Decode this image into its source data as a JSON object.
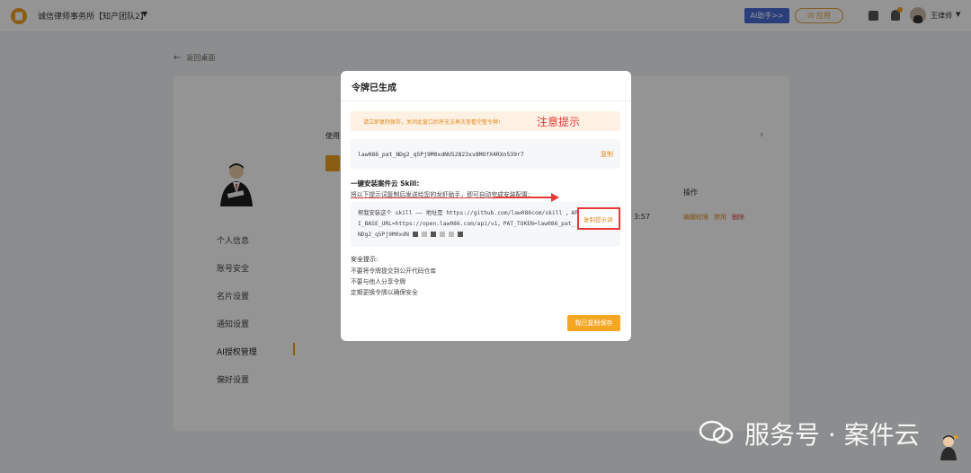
{
  "topbar": {
    "logo_glyph": "▆",
    "firm_name": "诚信律师事务所【知产团队2】",
    "ai_button": "AI助手>>",
    "use_button": "☒ 应用",
    "user_name": "王律师"
  },
  "back_link": "返回桌面",
  "background_page": {
    "usage_label": "使用",
    "ops_header": "操作",
    "time_fragment": "3:57",
    "ops": [
      "编辑权限",
      "禁用",
      "删除"
    ],
    "sidebar": [
      {
        "label": "个人信息"
      },
      {
        "label": "账号安全"
      },
      {
        "label": "名片设置"
      },
      {
        "label": "通知设置"
      },
      {
        "label": "AI授权管理",
        "active": true
      },
      {
        "label": "偏好设置"
      }
    ]
  },
  "modal": {
    "title": "令牌已生成",
    "warning": "请立即复制保存，关闭此窗口后将无法再次查看完整令牌!",
    "annotation": "注意提示",
    "token": "law086_pat_NDg2_q5Pj9M0xdNU52823xv8MOfX4RXn539r7",
    "copy_label": "复制",
    "install_title": "一键安装案件云 Skill:",
    "install_desc": "将以下提示词复制后发送给您的龙虾助手，即可自动完成安装配置:",
    "prompt_text": "帮我安装这个 skill —— 地址是 https://github.com/law086com/skill ，API_BASE_URL=https://open.law086.com/api/v1，PAT_TOKEN=law086_pat_NDg2_q5Pj9M0xdN",
    "copy_prompt_label": "复制提示词",
    "safety_title": "安全提示:",
    "safety_items": [
      "不要将令牌提交到公开代码仓库",
      "不要与他人分享令牌",
      "定期更换令牌以确保安全"
    ],
    "saved_button": "我已复制保存"
  },
  "watermark": "服务号 · 案件云",
  "colors": {
    "accent": "#f5a623",
    "annotation_red": "#e53935",
    "ai_blue": "#4a6bd6"
  }
}
